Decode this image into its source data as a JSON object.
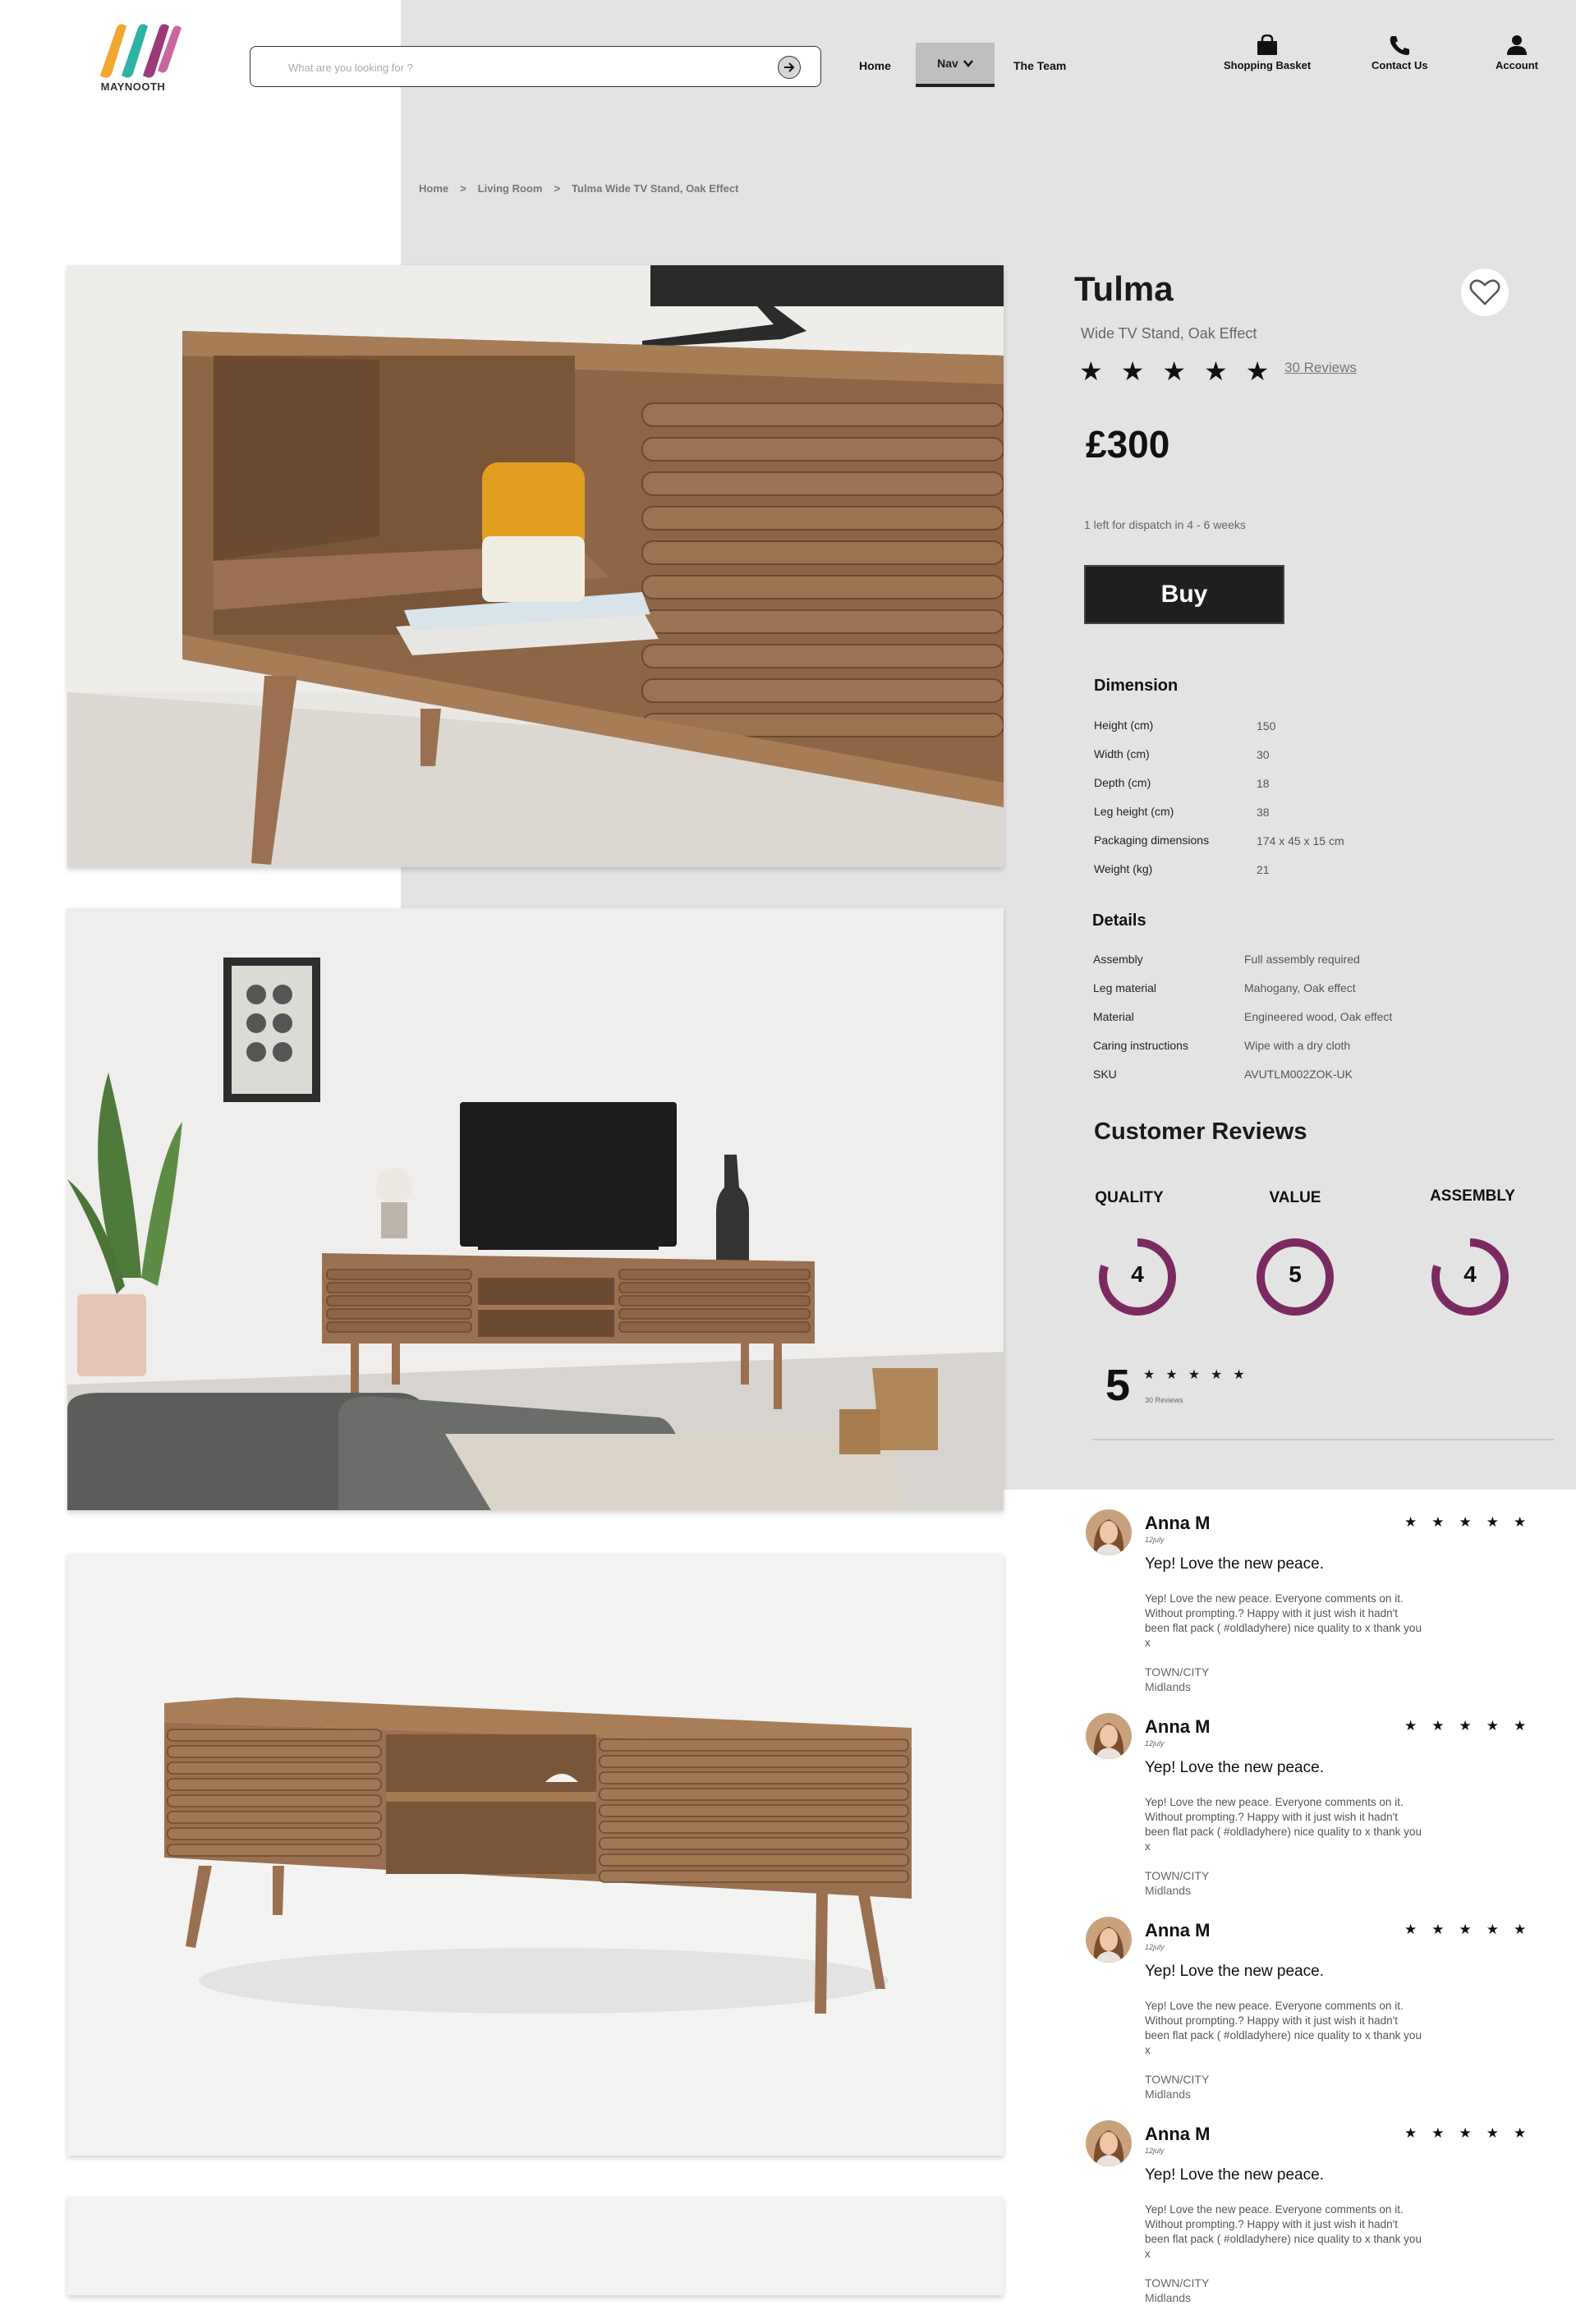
{
  "brand": {
    "name": "MAYNOOTH"
  },
  "header": {
    "search_placeholder": "What are you looking for ?",
    "nav": {
      "home": "Home",
      "nav": "Nav",
      "team": "The Team"
    },
    "actions": {
      "basket": "Shopping Basket",
      "contact": "Contact Us",
      "account": "Account"
    }
  },
  "breadcrumb": {
    "items": [
      "Home",
      ">",
      "Living Room",
      ">",
      "Tulma Wide TV Stand, Oak Effect"
    ]
  },
  "product": {
    "title": "Tulma",
    "subtitle": "Wide TV Stand, Oak Effect",
    "rating": 5,
    "stars": "★",
    "reviews_link": "30 Reviews",
    "price": "£300",
    "dispatch": "1 left for dispatch in 4 - 6 weeks",
    "buy_label": "Buy"
  },
  "dimension": {
    "heading": "Dimension",
    "rows": [
      {
        "label": "Height (cm)",
        "value": "150"
      },
      {
        "label": "Width (cm)",
        "value": "30"
      },
      {
        "label": "Depth (cm)",
        "value": "18"
      },
      {
        "label": "Leg height (cm)",
        "value": "38"
      },
      {
        "label": "Packaging dimensions",
        "value": "174 x 45 x  15 cm"
      },
      {
        "label": "Weight (kg)",
        "value": "21"
      }
    ]
  },
  "details": {
    "heading": "Details",
    "rows": [
      {
        "label": "Assembly",
        "value": "Full assembly required"
      },
      {
        "label": "Leg material",
        "value": "Mahogany, Oak effect"
      },
      {
        "label": "Material",
        "value": "Engineered wood, Oak effect"
      },
      {
        "label": "Caring instructions",
        "value": "Wipe with a dry cloth"
      },
      {
        "label": "SKU",
        "value": "AVUTLM002ZOK-UK"
      }
    ]
  },
  "customer_reviews": {
    "heading": "Customer Reviews",
    "metrics": [
      {
        "label": "QUALITY",
        "score": "4",
        "fraction": 0.8
      },
      {
        "label": "VALUE",
        "score": "5",
        "fraction": 1.0
      },
      {
        "label": "ASSEMBLY",
        "score": "4",
        "fraction": 0.8
      }
    ],
    "accent": "#7b2a61",
    "overall": "5",
    "overall_count": "30 Reviews"
  },
  "reviews": [
    {
      "name": "Anna M",
      "date": "12july",
      "headline": "Yep! Love the new peace.",
      "body": "Yep! Love the new peace. Everyone comments on it. Without prompting.? Happy with it just wish it hadn't been flat pack ( #oldladyhere) nice quality to x thank you x",
      "town_label": "TOWN/CITY",
      "town": "Midlands"
    },
    {
      "name": "Anna M",
      "date": "12july",
      "headline": "Yep! Love the new peace.",
      "body": "Yep! Love the new peace. Everyone comments on it. Without prompting.? Happy with it just wish it hadn't been flat pack ( #oldladyhere) nice quality to x thank you x",
      "town_label": "TOWN/CITY",
      "town": "Midlands"
    },
    {
      "name": "Anna M",
      "date": "12july",
      "headline": "Yep! Love the new peace.",
      "body": "Yep! Love the new peace. Everyone comments on it. Without prompting.? Happy with it just wish it hadn't been flat pack ( #oldladyhere) nice quality to x thank you x",
      "town_label": "TOWN/CITY",
      "town": "Midlands"
    },
    {
      "name": "Anna M",
      "date": "12july",
      "headline": "Yep! Love the new peace.",
      "body": "Yep! Love the new peace. Everyone comments on it. Without prompting.? Happy with it just wish it hadn't been flat pack ( #oldladyhere) nice quality to x thank you x",
      "town_label": "TOWN/CITY",
      "town": "Midlands"
    }
  ]
}
